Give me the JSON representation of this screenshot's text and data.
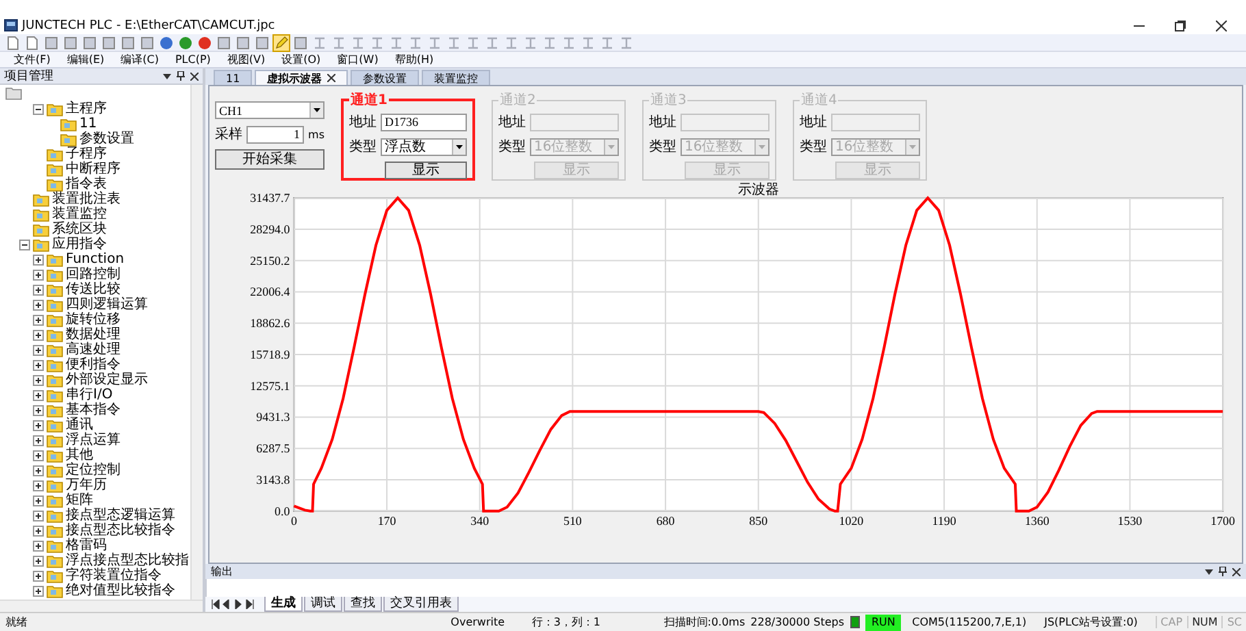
{
  "window": {
    "title": "JUNCTECH PLC - E:\\EtherCAT\\CAMCUT.jpc"
  },
  "menu": [
    "文件(F)",
    "编辑(E)",
    "编译(C)",
    "PLC(P)",
    "视图(V)",
    "设置(O)",
    "窗口(W)",
    "帮助(H)"
  ],
  "project_panel": {
    "title": "项目管理"
  },
  "tree": {
    "program_items": [
      {
        "label": "主程序",
        "expanded": true,
        "children": [
          {
            "label": "11"
          },
          {
            "label": "参数设置"
          }
        ]
      },
      {
        "label": "子程序"
      },
      {
        "label": "中断程序"
      },
      {
        "label": "指令表"
      }
    ],
    "items": [
      {
        "label": "装置批注表"
      },
      {
        "label": "装置监控"
      },
      {
        "label": "系统区块"
      },
      {
        "label": "应用指令",
        "expanded": true,
        "children": [
          {
            "label": "Function",
            "expanded": false
          },
          {
            "label": "回路控制",
            "expanded": false
          },
          {
            "label": "传送比较",
            "expanded": false
          },
          {
            "label": "四则逻辑运算",
            "expanded": false
          },
          {
            "label": "旋转位移",
            "expanded": false
          },
          {
            "label": "数据处理",
            "expanded": false
          },
          {
            "label": "高速处理",
            "expanded": false
          },
          {
            "label": "便利指令",
            "expanded": false
          },
          {
            "label": "外部设定显示",
            "expanded": false
          },
          {
            "label": "串行I/O",
            "expanded": false
          },
          {
            "label": "基本指令",
            "expanded": false
          },
          {
            "label": "通讯",
            "expanded": false
          },
          {
            "label": "浮点运算",
            "expanded": false
          },
          {
            "label": "其他",
            "expanded": false
          },
          {
            "label": "定位控制",
            "expanded": false
          },
          {
            "label": "万年历",
            "expanded": false
          },
          {
            "label": "矩阵",
            "expanded": false
          },
          {
            "label": "接点型态逻辑运算",
            "expanded": false
          },
          {
            "label": "接点型态比较指令",
            "expanded": false
          },
          {
            "label": "格雷码",
            "expanded": false
          },
          {
            "label": "浮点接点型态比较指",
            "expanded": false
          },
          {
            "label": "字符装置位指令",
            "expanded": false
          },
          {
            "label": "绝对值型比较指令",
            "expanded": false
          }
        ]
      }
    ]
  },
  "tabs": [
    {
      "label": "11",
      "selected": false
    },
    {
      "label": "虚拟示波器",
      "selected": true
    },
    {
      "label": "参数设置",
      "selected": false
    },
    {
      "label": "装置监控",
      "selected": false
    }
  ],
  "scope": {
    "channel_select": "CH1",
    "sample_label": "采样",
    "sample_value": "1",
    "sample_unit": "ms",
    "start_button": "开始采集",
    "channels": [
      {
        "title": "通道1",
        "enabled": true,
        "highlighted": true,
        "address_label": "地址",
        "address": "D1736",
        "type_label": "类型",
        "type": "浮点数",
        "button": "显示"
      },
      {
        "title": "通道2",
        "enabled": false,
        "highlighted": false,
        "address_label": "地址",
        "type_label": "类型",
        "type": "16位整数",
        "button": "显示"
      },
      {
        "title": "通道3",
        "enabled": false,
        "highlighted": false,
        "address_label": "地址",
        "type_label": "类型",
        "type": "16位整数",
        "button": "显示"
      },
      {
        "title": "通道4",
        "enabled": false,
        "highlighted": false,
        "address_label": "地址",
        "type_label": "类型",
        "type": "16位整数",
        "button": "显示"
      }
    ],
    "chart_data": {
      "type": "line",
      "title": "示波器",
      "x": [
        0,
        10,
        20,
        30,
        34,
        36,
        50,
        70,
        90,
        110,
        130,
        150,
        170,
        190,
        210,
        230,
        250,
        270,
        290,
        310,
        330,
        345,
        347,
        375,
        390,
        410,
        430,
        450,
        470,
        490,
        505,
        850,
        860,
        880,
        900,
        920,
        940,
        960,
        980,
        990,
        995,
        1000,
        1020,
        1040,
        1060,
        1080,
        1100,
        1120,
        1140,
        1160,
        1180,
        1200,
        1220,
        1240,
        1260,
        1280,
        1300,
        1320,
        1322,
        1345,
        1360,
        1380,
        1400,
        1420,
        1440,
        1460,
        1470,
        1700
      ],
      "series": [
        {
          "color": "#ff0000",
          "values": [
            500,
            300,
            100,
            0,
            0,
            2700,
            4300,
            7200,
            11300,
            16400,
            21800,
            26700,
            30200,
            31437.7,
            30200,
            26700,
            21800,
            16400,
            11300,
            7200,
            4300,
            2700,
            0,
            0,
            400,
            1800,
            3900,
            6100,
            8200,
            9600,
            10000,
            10000,
            9900,
            8800,
            7100,
            5000,
            2900,
            1200,
            200,
            0,
            0,
            2700,
            4300,
            7200,
            11300,
            16400,
            21800,
            26700,
            30200,
            31437.7,
            30200,
            26700,
            21800,
            16400,
            11300,
            7200,
            4300,
            2700,
            0,
            0,
            400,
            1900,
            4100,
            6500,
            8600,
            9800,
            10000,
            10000
          ]
        }
      ],
      "grid": true,
      "xlim": [
        0,
        1700
      ],
      "ylim": [
        0,
        31437.7
      ],
      "xticks": [
        0,
        170,
        340,
        510,
        680,
        850,
        1020,
        1190,
        1360,
        1530,
        1700
      ],
      "yticks": [
        {
          "value": 0,
          "label": "0.0"
        },
        {
          "value": 3143.8,
          "label": "3143.8"
        },
        {
          "value": 6287.5,
          "label": "6287.5"
        },
        {
          "value": 9431.3,
          "label": "9431.3"
        },
        {
          "value": 12575.1,
          "label": "12575.1"
        },
        {
          "value": 15718.9,
          "label": "15718.9"
        },
        {
          "value": 18862.6,
          "label": "18862.6"
        },
        {
          "value": 22006.4,
          "label": "22006.4"
        },
        {
          "value": 25150.2,
          "label": "25150.2"
        },
        {
          "value": 28294.0,
          "label": "28294.0"
        },
        {
          "value": 31437.7,
          "label": "31437.7"
        }
      ]
    }
  },
  "output_panel": {
    "title": "输出",
    "tabs": [
      {
        "label": "生成",
        "selected": true
      },
      {
        "label": "调试",
        "selected": false
      },
      {
        "label": "查找",
        "selected": false
      },
      {
        "label": "交叉引用表",
        "selected": false
      }
    ]
  },
  "status_bar": {
    "ready": "就绪",
    "mode": "Overwrite",
    "position": "行：3，列：1",
    "scan_time": "扫描时间:0.0ms",
    "steps": "228/30000 Steps",
    "run": true,
    "run_label": "RUN",
    "port": "COM5(115200,7,E,1)",
    "station": "JS(PLC站号设置:0)",
    "keys": [
      {
        "label": "CAP",
        "on": false
      },
      {
        "label": "NUM",
        "on": true
      },
      {
        "label": "SC",
        "on": false
      }
    ]
  }
}
